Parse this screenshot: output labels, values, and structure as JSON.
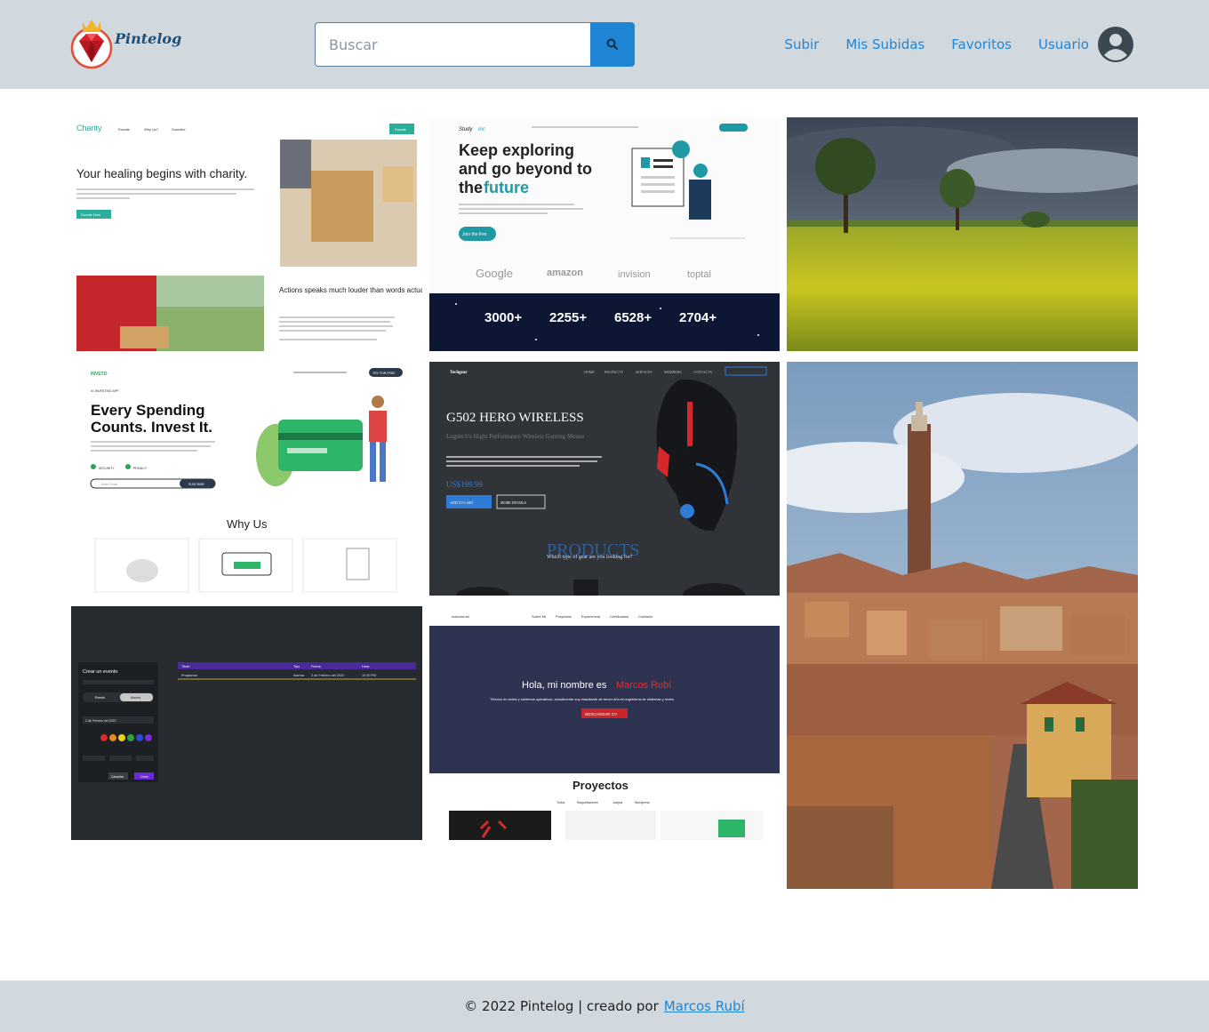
{
  "header": {
    "logo_text": "Pintelog",
    "search": {
      "placeholder": "Buscar",
      "value": ""
    },
    "nav": {
      "upload": "Subir",
      "my_uploads": "Mis Subidas",
      "favorites": "Favoritos",
      "user": "Usuario"
    }
  },
  "tiles": {
    "charity": {
      "brand": "Charity",
      "nav": [
        "Donate",
        "Why Us?",
        "Suscribe"
      ],
      "button": "Donate",
      "headline": "Your healing begins with charity.",
      "cta": "Donate Now",
      "quote": "Actions speaks much louder than words actually"
    },
    "study": {
      "brand": "Study",
      "brand_suffix": "inc",
      "headline_1": "Keep exploring",
      "headline_2": "and go beyond to",
      "headline_3": "the",
      "headline_accent": "future",
      "cta": "Join the free",
      "logos": [
        "Google",
        "amazon",
        "invision",
        "toptal"
      ],
      "stats": [
        "3000+",
        "2255+",
        "6528+",
        "2704+"
      ]
    },
    "inveto": {
      "brand": "INVETO",
      "tag": "#1 INVESTING APP",
      "headline_1": "Every Spending",
      "headline_2": "Counts. Invest It.",
      "badge_1": "SECURITY",
      "badge_2": "PRIVACY",
      "input_placeholder": "Enter Email",
      "subscribe": "SUSCRIBE",
      "section": "Why Us",
      "cta": "TRY FOR FREE"
    },
    "techgear": {
      "brand": "Techgear",
      "nav": [
        "HOME",
        "PRODUCTS",
        "SERVICES",
        "MEMBERS",
        "CONTACTS"
      ],
      "headline": "G502 HERO WIRELESS",
      "sub": "Logitech's Hight Performance Wireless Gaming Mouse",
      "price": "US$199.99",
      "btn_cart": "ADD TO CART",
      "btn_more": "MORE DETAILS",
      "section": "PRODUCTS",
      "section_sub": "Which type of gear are you looking for?"
    },
    "events": {
      "form_title": "Crear un evento",
      "toggle_1": "Evento",
      "toggle_2": "Alarma",
      "date": "2 de Febrero del 2022",
      "btn_cancel": "Cancelar",
      "btn_create": "Crear",
      "table_headers": [
        "Título",
        "Tipo",
        "Fecha",
        "Hora"
      ],
      "row": [
        "Programar",
        "Alarma",
        "2 de Febrero del 2022",
        "10:30 PM"
      ]
    },
    "portfolio": {
      "brand": "marcosrubi",
      "nav": [
        "Sobre Mi",
        "Proyectos",
        "Experiencia",
        "Certificados",
        "Contacto"
      ],
      "hello": "Hola, mi nombre es",
      "name": "Marcos Rubí",
      "sub": "Técnico en redes y sistemas operativos, actualmente soy estudiante de tercer año en ingeniería de sistemas y redes.",
      "cta": "DESCARGAR CV",
      "section": "Proyectos",
      "filters": [
        "Todos",
        "Maquetaciones",
        "Juegos",
        "Wordpress"
      ]
    }
  },
  "footer": {
    "text": "© 2022 Pintelog | creado por",
    "author": "Marcos Rubí"
  },
  "colors": {
    "header_bg": "#d1d8de",
    "accent": "#1f86d6"
  }
}
